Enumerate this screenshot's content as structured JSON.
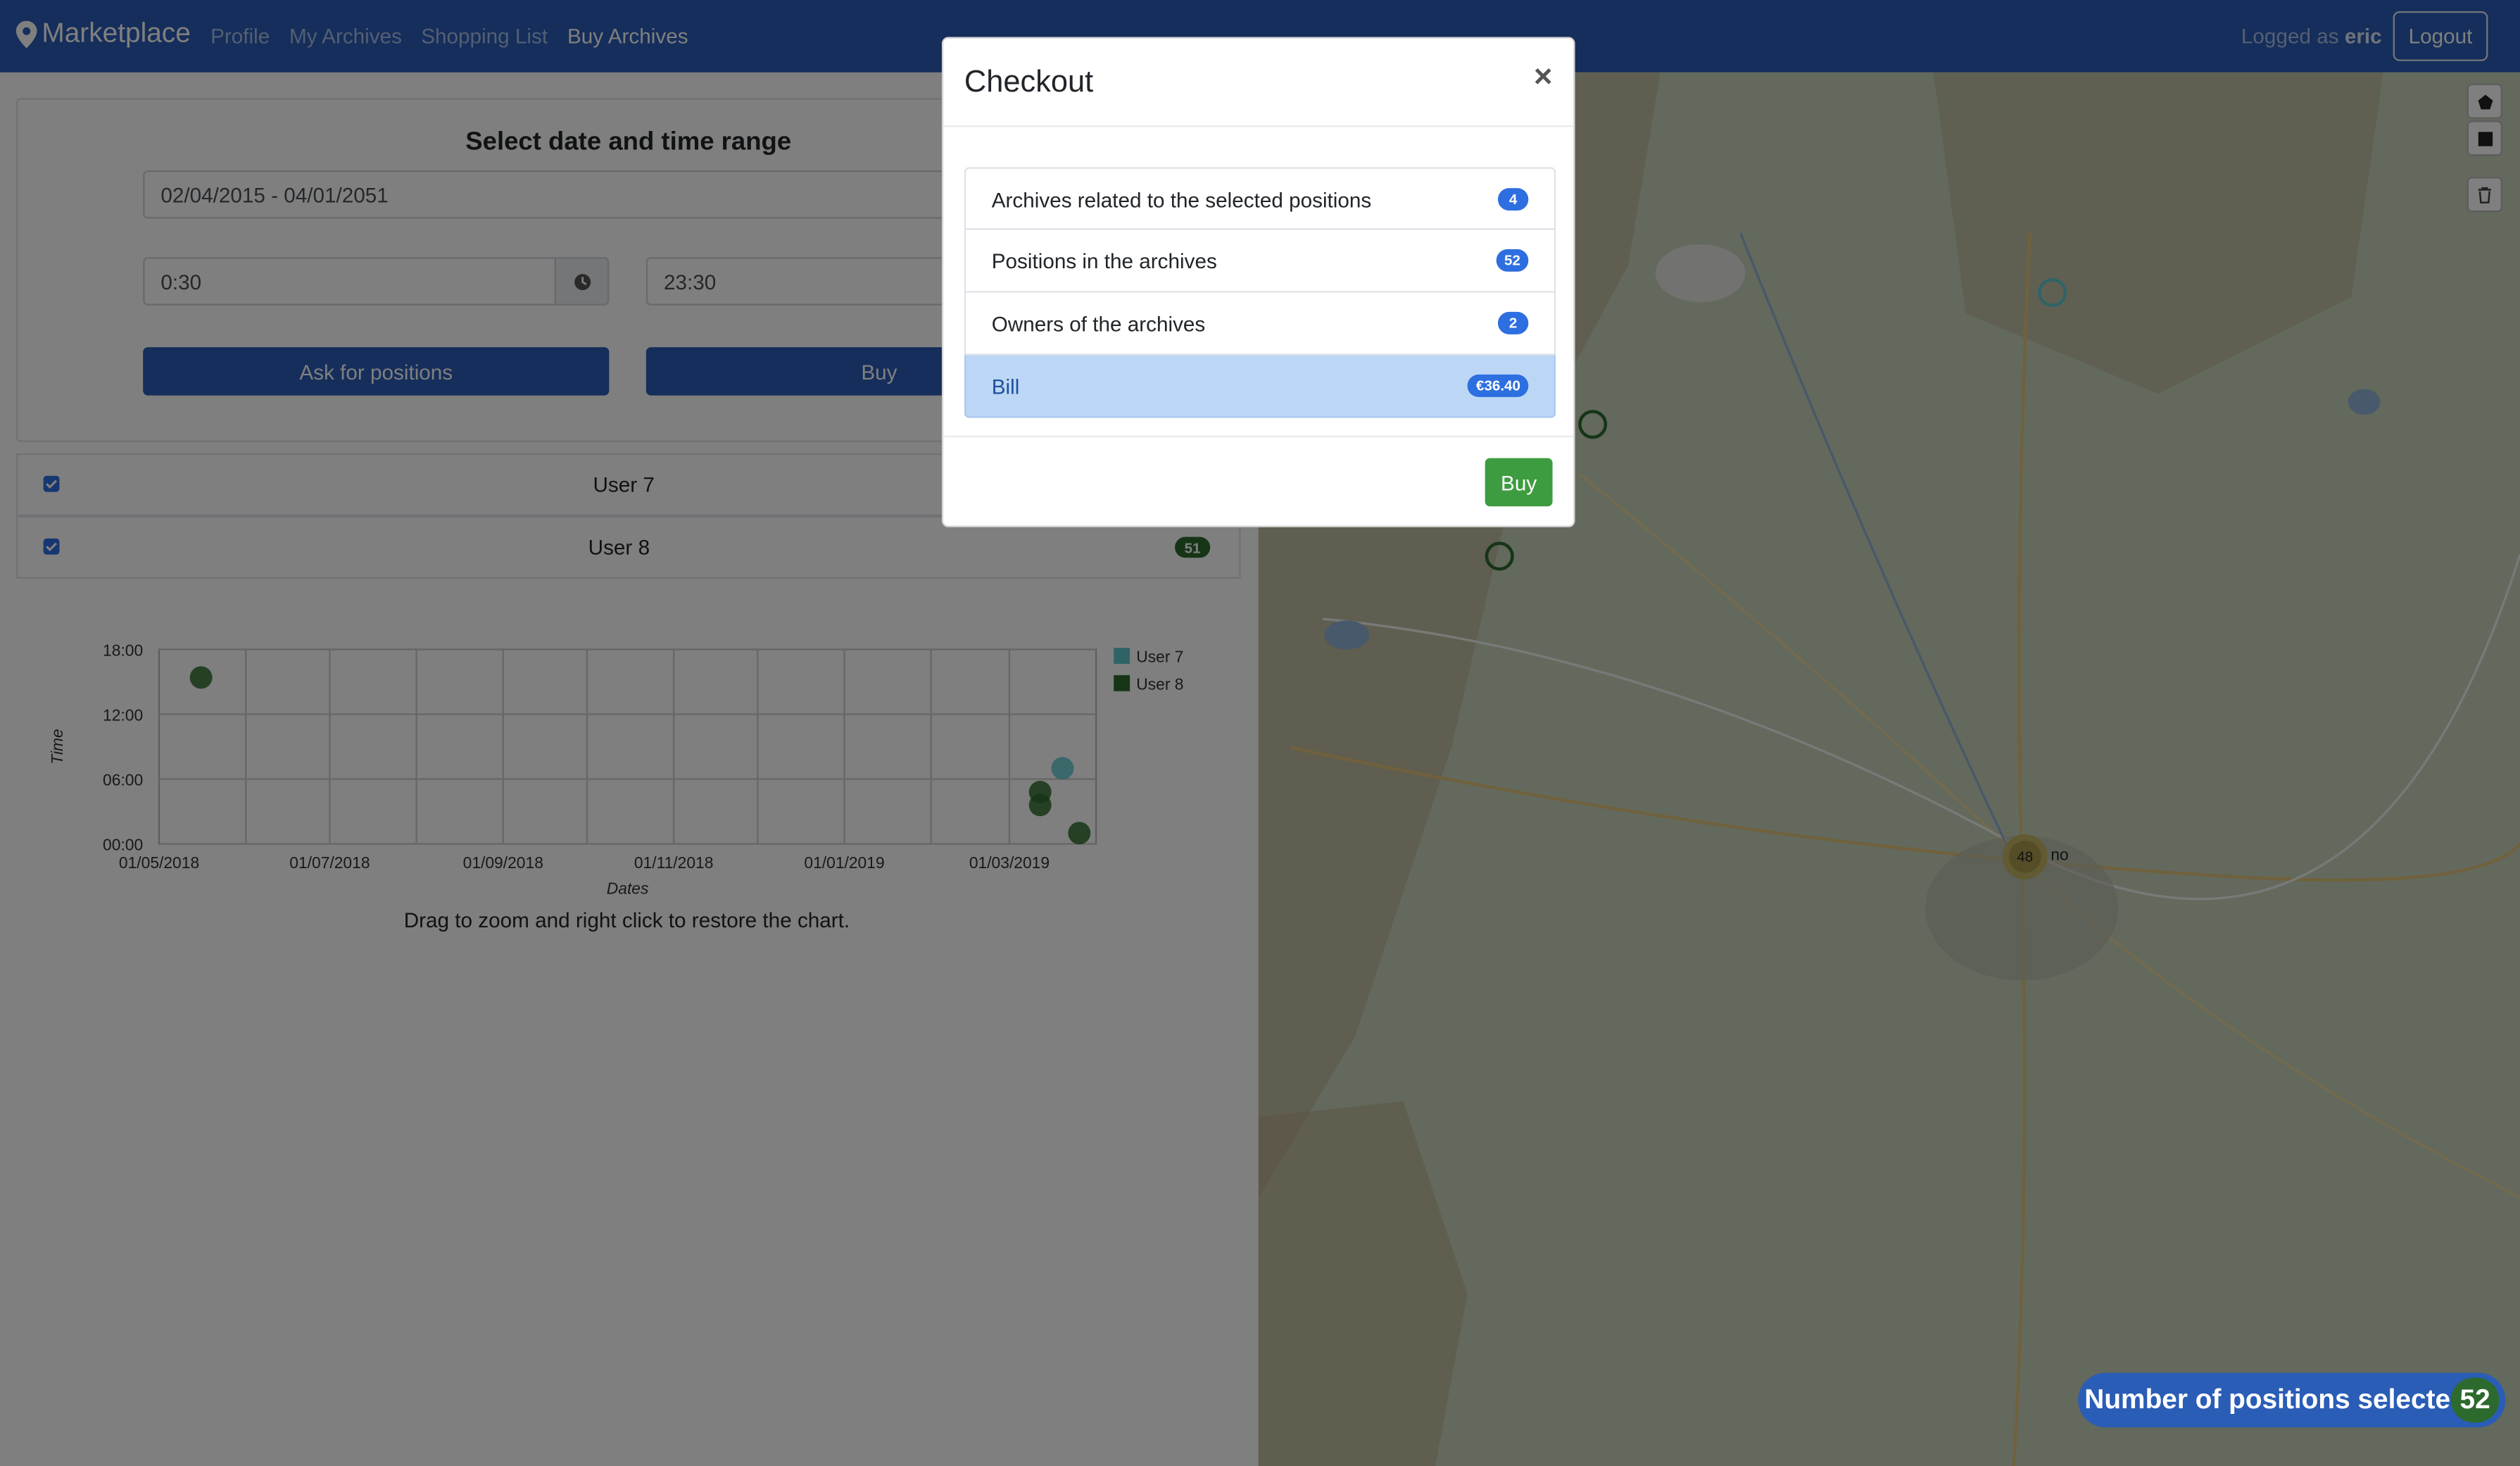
{
  "navbar": {
    "brand": "Marketplace",
    "links": [
      "Profile",
      "My Archives",
      "Shopping List",
      "Buy Archives"
    ],
    "active_link": "Buy Archives",
    "logged_prefix": "Logged as",
    "username": "eric",
    "logout": "Logout"
  },
  "filters": {
    "title": "Select date and time range",
    "date_range": "02/04/2015 - 04/01/2051",
    "time_from": "0:30",
    "time_to": "23:30",
    "ask_button": "Ask for positions",
    "buy_button": "Buy"
  },
  "users": [
    {
      "name": "User 7",
      "checked": true,
      "count": ""
    },
    {
      "name": "User 8",
      "checked": true,
      "count": "51"
    }
  ],
  "chart_caption": "Drag to zoom and right click to restore the chart.",
  "chart_data": {
    "type": "scatter",
    "xlabel": "Dates",
    "ylabel": "Time",
    "x_ticks": [
      "01/05/2018",
      "01/07/2018",
      "01/09/2018",
      "01/11/2018",
      "01/01/2019",
      "01/03/2019"
    ],
    "y_ticks": [
      "00:00",
      "06:00",
      "12:00",
      "18:00"
    ],
    "xlim": [
      "2018-05-01",
      "2019-04-01"
    ],
    "ylim": [
      0,
      18
    ],
    "grid": true,
    "legend": "right",
    "series": [
      {
        "name": "User 7",
        "color": "#5fc9cc",
        "points": [
          {
            "x": "2019-03-20",
            "y": 7.0
          }
        ]
      },
      {
        "name": "User 8",
        "color": "#2d6a2e",
        "points": [
          {
            "x": "2018-05-16",
            "y": 15.4
          },
          {
            "x": "2019-03-12",
            "y": 4.8
          },
          {
            "x": "2019-03-12",
            "y": 3.6
          },
          {
            "x": "2019-03-26",
            "y": 1.0
          }
        ]
      }
    ]
  },
  "map": {
    "cluster_count": "48",
    "cluster_label": "no",
    "positions_label": "Number of positions selected:",
    "positions_count": "52"
  },
  "modal": {
    "title": "Checkout",
    "close": "×",
    "items": [
      {
        "label": "Archives related to the selected positions",
        "value": "4"
      },
      {
        "label": "Positions in the archives",
        "value": "52"
      },
      {
        "label": "Owners of the archives",
        "value": "2"
      },
      {
        "label": "Bill",
        "value": "€36.40"
      }
    ],
    "buy": "Buy"
  }
}
